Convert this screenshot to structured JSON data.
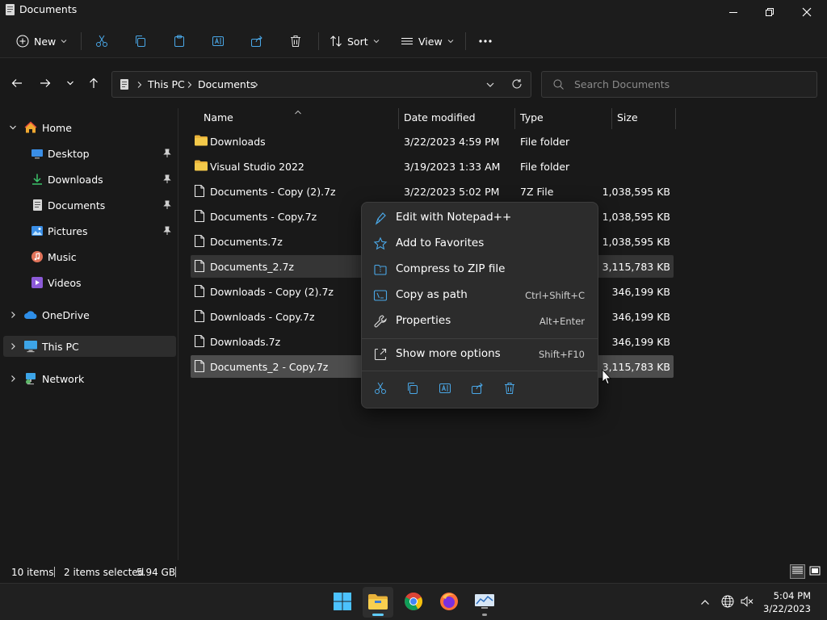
{
  "window": {
    "title": "Documents"
  },
  "toolbar": {
    "new_label": "New",
    "sort_label": "Sort",
    "view_label": "View"
  },
  "address": {
    "crumbs": [
      "This PC",
      "Documents"
    ],
    "search_placeholder": "Search Documents"
  },
  "sidebar": {
    "home": "Home",
    "quick": [
      {
        "label": "Desktop",
        "pinned": true
      },
      {
        "label": "Downloads",
        "pinned": true
      },
      {
        "label": "Documents",
        "pinned": true
      },
      {
        "label": "Pictures",
        "pinned": true
      },
      {
        "label": "Music",
        "pinned": false
      },
      {
        "label": "Videos",
        "pinned": false
      }
    ],
    "onedrive": "OneDrive",
    "thispc": "This PC",
    "network": "Network"
  },
  "columns": {
    "name": "Name",
    "date": "Date modified",
    "type": "Type",
    "size": "Size"
  },
  "files": [
    {
      "name": "Downloads",
      "date": "3/22/2023 4:59 PM",
      "type": "File folder",
      "size": "",
      "kind": "folder",
      "selected": ""
    },
    {
      "name": "Visual Studio 2022",
      "date": "3/19/2023 1:33 AM",
      "type": "File folder",
      "size": "",
      "kind": "folder",
      "selected": ""
    },
    {
      "name": "Documents - Copy (2).7z",
      "date": "3/22/2023 5:02 PM",
      "type": "7Z File",
      "size": "1,038,595 KB",
      "kind": "file",
      "selected": ""
    },
    {
      "name": "Documents - Copy.7z",
      "date": "",
      "type": "",
      "size": "1,038,595 KB",
      "kind": "file",
      "selected": ""
    },
    {
      "name": "Documents.7z",
      "date": "",
      "type": "",
      "size": "1,038,595 KB",
      "kind": "file",
      "selected": ""
    },
    {
      "name": "Documents_2.7z",
      "date": "",
      "type": "",
      "size": "3,115,783 KB",
      "kind": "file",
      "selected": "sel1"
    },
    {
      "name": "Downloads - Copy (2).7z",
      "date": "",
      "type": "",
      "size": "346,199 KB",
      "kind": "file",
      "selected": ""
    },
    {
      "name": "Downloads - Copy.7z",
      "date": "",
      "type": "",
      "size": "346,199 KB",
      "kind": "file",
      "selected": ""
    },
    {
      "name": "Downloads.7z",
      "date": "",
      "type": "",
      "size": "346,199 KB",
      "kind": "file",
      "selected": ""
    },
    {
      "name": "Documents_2 - Copy.7z",
      "date": "",
      "type": "",
      "size": "3,115,783 KB",
      "kind": "file",
      "selected": "sel2"
    }
  ],
  "context_menu": {
    "items": [
      {
        "label": "Edit with Notepad++",
        "shortcut": "",
        "icon": "notepadpp-icon"
      },
      {
        "label": "Add to Favorites",
        "shortcut": "",
        "icon": "star-icon"
      },
      {
        "label": "Compress to ZIP file",
        "shortcut": "",
        "icon": "zip-icon"
      },
      {
        "label": "Copy as path",
        "shortcut": "Ctrl+Shift+C",
        "icon": "copy-path-icon"
      },
      {
        "label": "Properties",
        "shortcut": "Alt+Enter",
        "icon": "wrench-icon"
      }
    ],
    "more": {
      "label": "Show more options",
      "shortcut": "Shift+F10"
    }
  },
  "status": {
    "count": "10 items",
    "selected": "2 items selected",
    "size": "5.94 GB"
  },
  "clock": {
    "time": "5:04 PM",
    "date": "3/22/2023"
  },
  "colors": {
    "accent": "#60cdff",
    "folder": "#f3c94a",
    "background": "#191919"
  }
}
